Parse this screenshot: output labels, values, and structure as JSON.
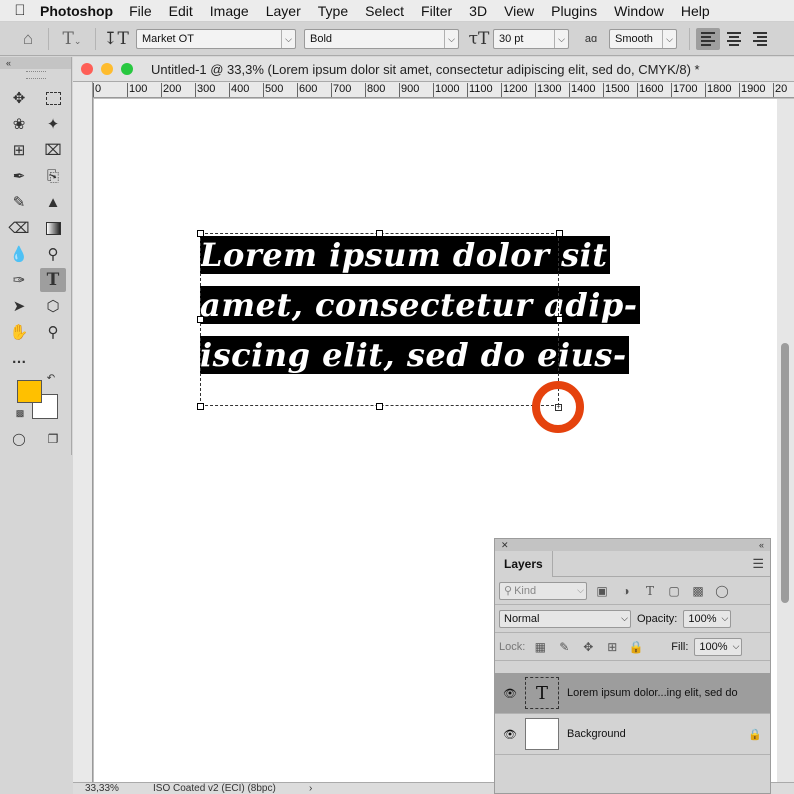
{
  "menubar": {
    "app": "Photoshop",
    "items": [
      "File",
      "Edit",
      "Image",
      "Layer",
      "Type",
      "Select",
      "Filter",
      "3D",
      "View",
      "Plugins",
      "Window",
      "Help"
    ]
  },
  "options": {
    "font_family": "Market OT",
    "font_style": "Bold",
    "font_size": "30 pt",
    "aa_label": "aɑ",
    "antialias": "Smooth"
  },
  "tools": {
    "foreground_color": "#ffc000",
    "background_color": "#ffffff"
  },
  "document": {
    "title": "Untitled-1 @ 33,3% (Lorem ipsum dolor sit amet, consectetur adipiscing elit, sed do, CMYK/8) *",
    "ruler_labels": [
      "0",
      "100",
      "200",
      "300",
      "400",
      "500",
      "600",
      "700",
      "800",
      "900",
      "1000",
      "1100",
      "1200",
      "1300",
      "1400",
      "1500",
      "1600",
      "1700",
      "1800",
      "1900",
      "20"
    ],
    "text_lines": [
      "Lorem ipsum dolor sit",
      "amet, consectetur adip-",
      "iscing elit, sed do eius-"
    ],
    "zoom": "33,33%",
    "profile": "ISO Coated v2 (ECI) (8bpc)",
    "status_arrow": "›"
  },
  "layers": {
    "tab": "Layers",
    "filter_placeholder": "Kind",
    "blend_mode": "Normal",
    "opacity_label": "Opacity:",
    "opacity": "100%",
    "lock_label": "Lock:",
    "fill_label": "Fill:",
    "fill": "100%",
    "items": [
      {
        "name": "Lorem ipsum dolor...ing elit, sed do",
        "thumb": "T"
      },
      {
        "name": "Background",
        "thumb": ""
      }
    ]
  },
  "colors": {
    "accent_ring": "#e5420d",
    "close": "#fe5f57",
    "minimize": "#febc2e",
    "zoom": "#28c840"
  }
}
